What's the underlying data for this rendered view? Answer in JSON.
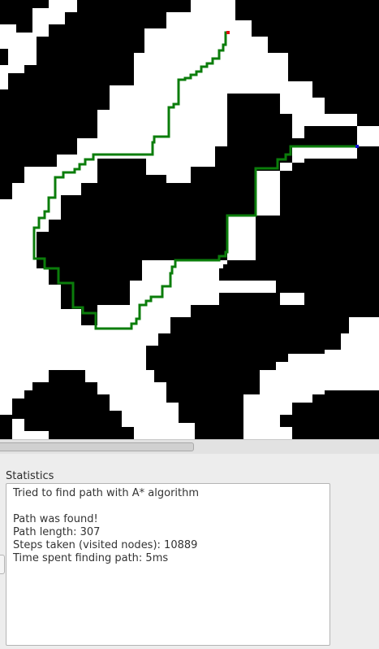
{
  "map": {
    "wall_color": "#000000",
    "floor_color": "#ffffff",
    "path_color": "#0b7d0b",
    "start_color": "#e01010",
    "goal_color": "#1010d0"
  },
  "statistics": {
    "label": "Statistics",
    "lines": [
      "Tried to find path with A* algorithm",
      "",
      "Path was found!",
      "Path length: 307",
      "Steps taken (visited nodes): 10889",
      "Time spent finding path: 5ms"
    ]
  }
}
